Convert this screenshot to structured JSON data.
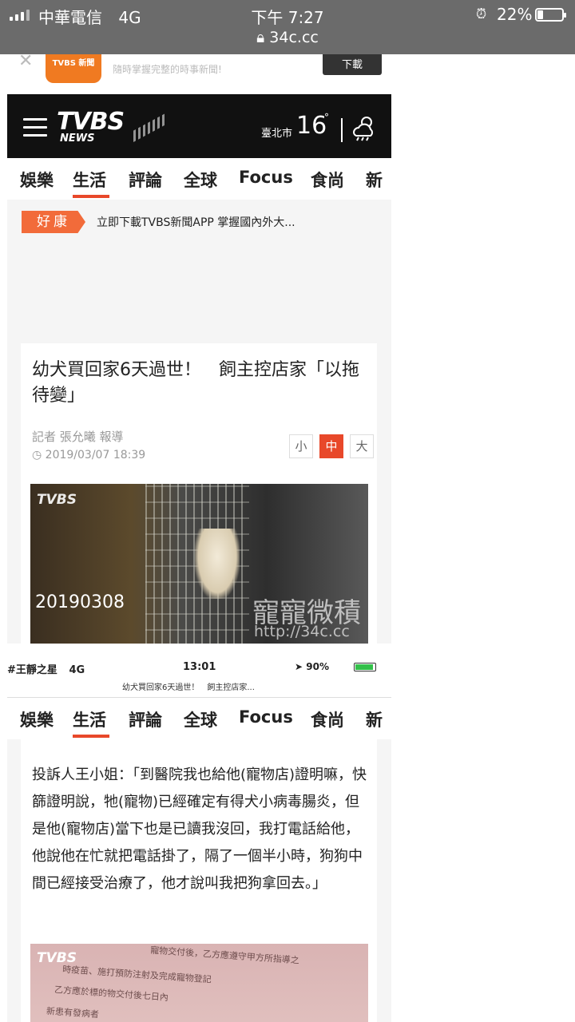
{
  "status_bar": {
    "carrier": "中華電信",
    "network": "4G",
    "time": "下午 7:27",
    "url": "34c.cc",
    "battery_percent": "22%",
    "battery_level": 0.22
  },
  "app_banner": {
    "app_name": "TVBS 新聞",
    "description": "隨時掌握完整的時事新聞!",
    "download_label": "下載"
  },
  "header": {
    "logo": "TVBS",
    "logo_sub": "NEWS",
    "city": "臺北市",
    "temperature": "16",
    "degree_symbol": "°"
  },
  "nav": {
    "items": [
      "娛樂",
      "生活",
      "評論",
      "全球",
      "Focus",
      "食尚",
      "新"
    ],
    "active": "生活"
  },
  "ticker": {
    "tag": "好康",
    "text": "立即下載TVBS新聞APP 掌握國內外大..."
  },
  "article": {
    "title": "幼犬買回家6天過世！　飼主控店家「以拖待變」",
    "byline": "記者 張允曦 報導",
    "date": "2019/03/07 18:39",
    "font_sizes": [
      "小",
      "中",
      "大"
    ],
    "font_size_active": "中",
    "photo": {
      "logo": "TVBS",
      "date": "20190308",
      "watermark": "寵寵微積",
      "watermark_url": "http://34c.cc"
    }
  },
  "inner_status": {
    "carrier": "#王靜之星",
    "network": "4G",
    "time": "13:01",
    "battery": "90%",
    "battery_level": 0.9,
    "subtitle": "幼犬買回家6天過世！　飼主控店家..."
  },
  "article2": {
    "body": "投訴人王小姐：「到醫院我也給他(寵物店)證明嘛，快篩證明說，牠(寵物)已經確定有得犬小病毒腸炎，但是他(寵物店)當下也是已讀我沒回，我打電話給他，他說他在忙就把電話掛了，隔了一個半小時，狗狗中間已經接受治療了，他才說叫我把狗拿回去。」",
    "photo_logo": "TVBS",
    "photo_text_lines": [
      "寵物交付後，乙方應遵守甲方所指導之",
      "時疫苗、施打預防注射及完成寵物登記",
      "乙方應於標的物交付後七日內",
      "新患有發病者"
    ]
  },
  "colors": {
    "accent": "#e8482a",
    "tag": "#f26b3a",
    "header_bg": "#111111",
    "status_bg": "#6b6b6b"
  }
}
